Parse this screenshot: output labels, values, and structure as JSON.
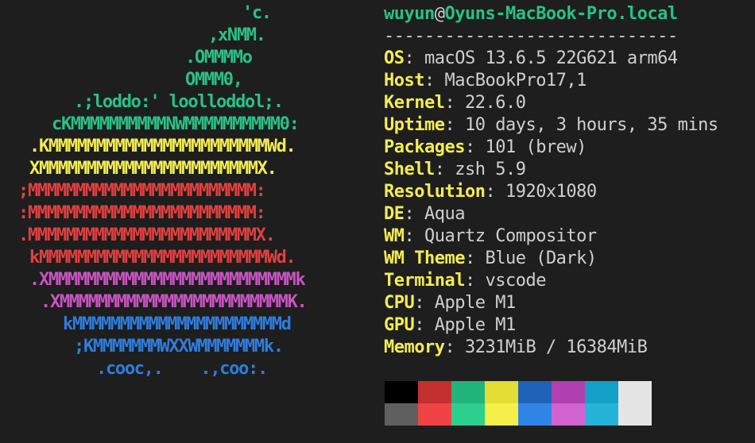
{
  "logo": {
    "lines": [
      {
        "text": "'c.",
        "color": "#2ac087"
      },
      {
        "text": ",xNMM.",
        "color": "#2ac087"
      },
      {
        "text": ".OMMMMo",
        "color": "#2ac087"
      },
      {
        "text": "OMMM0,",
        "color": "#2ac087"
      },
      {
        "text": ".;loddo:' loolloddol;.",
        "color": "#2ac087"
      },
      {
        "text": "cKMMMMMMMMMMNWMMMMMMMMMM0:",
        "color": "#2ac087"
      },
      {
        "text": ".KMMMMMMMMMMMMMMMMMMMMMMMWd.",
        "color": "#f3ec52"
      },
      {
        "text": "XMMMMMMMMMMMMMMMMMMMMMMMX.",
        "color": "#f3ec52"
      },
      {
        "text": ";MMMMMMMMMMMMMMMMMMMMMMMM:",
        "color": "#e23f3f"
      },
      {
        "text": ":MMMMMMMMMMMMMMMMMMMMMMMM:",
        "color": "#e23f3f"
      },
      {
        "text": ".MMMMMMMMMMMMMMMMMMMMMMMMX.",
        "color": "#e23f3f"
      },
      {
        "text": "kMMMMMMMMMMMMMMMMMMMMMMMMWd.",
        "color": "#e23f3f"
      },
      {
        "text": ".XMMMMMMMMMMMMMMMMMMMMMMMMMMk",
        "color": "#c854c2"
      },
      {
        "text": ".XMMMMMMMMMMMMMMMMMMMMMMMMK.",
        "color": "#c854c2"
      },
      {
        "text": "kMMMMMMMMMMMMMMMMMMMMMMd",
        "color": "#2f7ddc"
      },
      {
        "text": ";KMMMMMMMWXXWMMMMMMMk.",
        "color": "#2f7ddc"
      },
      {
        "text": ".cooc,.    .,coo:.",
        "color": "#2f7ddc"
      }
    ]
  },
  "title": {
    "user": "wuyun",
    "at": "@",
    "host": "Oyuns-MacBook-Pro.local"
  },
  "separator": "-----------------------------",
  "info": [
    {
      "key": "OS",
      "value": "macOS 13.6.5 22G621 arm64"
    },
    {
      "key": "Host",
      "value": "MacBookPro17,1"
    },
    {
      "key": "Kernel",
      "value": "22.6.0"
    },
    {
      "key": "Uptime",
      "value": "10 days, 3 hours, 35 mins"
    },
    {
      "key": "Packages",
      "value": "101 (brew)"
    },
    {
      "key": "Shell",
      "value": "zsh 5.9"
    },
    {
      "key": "Resolution",
      "value": "1920x1080"
    },
    {
      "key": "DE",
      "value": "Aqua"
    },
    {
      "key": "WM",
      "value": "Quartz Compositor"
    },
    {
      "key": "WM Theme",
      "value": "Blue (Dark)"
    },
    {
      "key": "Terminal",
      "value": "vscode"
    },
    {
      "key": "CPU",
      "value": "Apple M1"
    },
    {
      "key": "GPU",
      "value": "Apple M1"
    },
    {
      "key": "Memory",
      "value": "3231MiB / 16384MiB"
    }
  ],
  "palette": {
    "normal": [
      "#000000",
      "#c4302f",
      "#21b57c",
      "#e3dc33",
      "#1f63b8",
      "#b03fb0",
      "#12a0c6",
      "#e5e5e5"
    ],
    "bright": [
      "#5f5f5f",
      "#f04444",
      "#2dcf8d",
      "#f5ef4a",
      "#2f86e6",
      "#d163d1",
      "#25b4d8",
      "#e5e5e5"
    ]
  }
}
